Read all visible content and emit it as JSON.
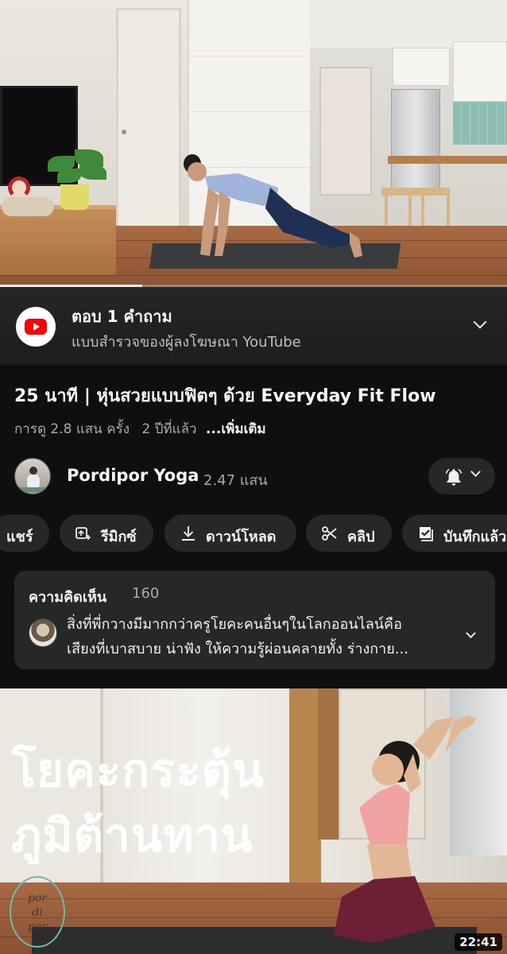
{
  "player": {
    "progress_fraction": 0.28
  },
  "survey": {
    "title": "ตอบ 1 คำถาม",
    "subtitle": "แบบสำรวจของผู้ลงโฆษณา YouTube"
  },
  "video": {
    "title": "25 นาที | หุ่นสวยแบบฟิตๆ ด้วย Everyday Fit Flow",
    "views": "การดู 2.8 แสน ครั้ง",
    "age": "2 ปีที่แล้ว",
    "more_label": "...เพิ่มเติม"
  },
  "channel": {
    "name": "Pordipor Yoga",
    "subscribers": "2.47 แสน"
  },
  "actions": [
    {
      "label": "แชร์",
      "icon": "share-icon"
    },
    {
      "label": "รีมิกซ์",
      "icon": "remix-icon"
    },
    {
      "label": "ดาวน์โหลด",
      "icon": "download-icon"
    },
    {
      "label": "คลิป",
      "icon": "scissors-icon"
    },
    {
      "label": "บันทึกแล้ว",
      "icon": "saved-playlist-icon"
    }
  ],
  "comments": {
    "heading": "ความคิดเห็น",
    "count": "160",
    "top_comment_line1": "สิ่งที่พี่กวางมีมากกว่าครูโยคะคนอื่นๆในโลกออนไลน์คือ",
    "top_comment_line2": "เสียงที่เบาสบาย น่าฟัง ให้ความรู้ผ่อนคลายทั้ง ร่างกาย..."
  },
  "next_video": {
    "thumb_title_line1": "โยคะกระตุ้น",
    "thumb_title_line2": "ภูมิต้านทาน",
    "logo_line1": "por",
    "logo_line2": "di",
    "logo_line3": "por",
    "duration": "22:41"
  },
  "colors": {
    "background": "#0f0f0f",
    "chip": "#272727",
    "youtube_red": "#ff0000",
    "secondary_text": "#aaaaaa"
  }
}
